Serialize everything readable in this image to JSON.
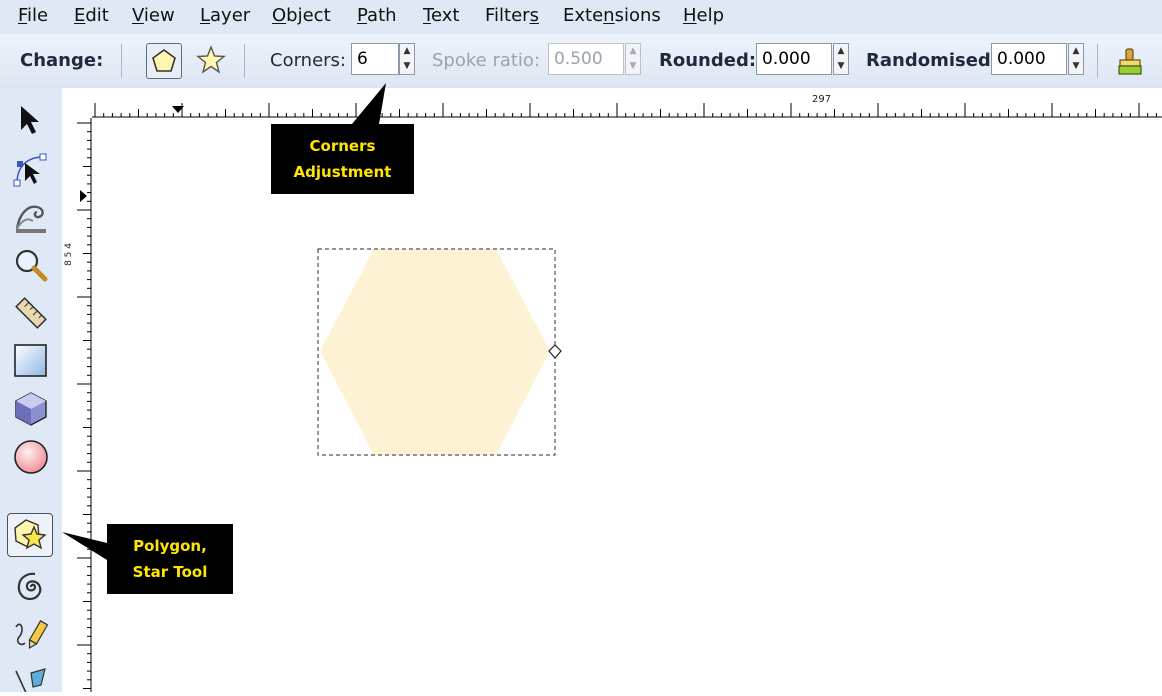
{
  "menu": {
    "items": [
      {
        "text": "File",
        "accel": "F",
        "rest": "ile"
      },
      {
        "text": "Edit",
        "accel": "E",
        "rest": "dit"
      },
      {
        "text": "View",
        "accel": "V",
        "rest": "iew"
      },
      {
        "text": "Layer",
        "pre": "",
        "accel": "L",
        "rest": "ayer"
      },
      {
        "text": "Object",
        "accel": "O",
        "rest": "bject"
      },
      {
        "text": "Path",
        "accel": "P",
        "rest": "ath"
      },
      {
        "text": "Text",
        "accel": "T",
        "rest": "ext"
      },
      {
        "text": "Filters",
        "pre": "Filter",
        "accel": "s",
        "rest": ""
      },
      {
        "text": "Extensions",
        "pre": "Exte",
        "accel": "n",
        "rest": "sions"
      },
      {
        "text": "Help",
        "accel": "H",
        "rest": "elp"
      }
    ]
  },
  "toolbar": {
    "change_label": "Change:",
    "corners_label": "Corners:",
    "corners_value": "6",
    "spoke_label": "Spoke ratio:",
    "spoke_value": "0.500",
    "rounded_label": "Rounded:",
    "rounded_value": "0.000",
    "randomised_label": "Randomised:",
    "randomised_value": "0.000"
  },
  "ruler": {
    "top_mark": "297",
    "left_mark": "8 5 4"
  },
  "canvas": {
    "shape": "hexagon",
    "fill_color": "#fdf2d4"
  },
  "callouts": {
    "corners": [
      "Corners",
      "Adjustment"
    ],
    "polygon_tool": [
      "Polygon,",
      "Star Tool"
    ]
  },
  "colors": {
    "chrome": "#dfe8f5",
    "callout_bg": "#000000",
    "callout_text": "#ffe600"
  },
  "tools": [
    "selector-icon",
    "node-editor-icon",
    "tweak-icon",
    "zoom-icon",
    "measure-icon",
    "rectangle-icon",
    "3d-box-icon",
    "ellipse-icon",
    "star-polygon-icon",
    "spiral-icon",
    "pencil-icon",
    "pen-icon"
  ]
}
